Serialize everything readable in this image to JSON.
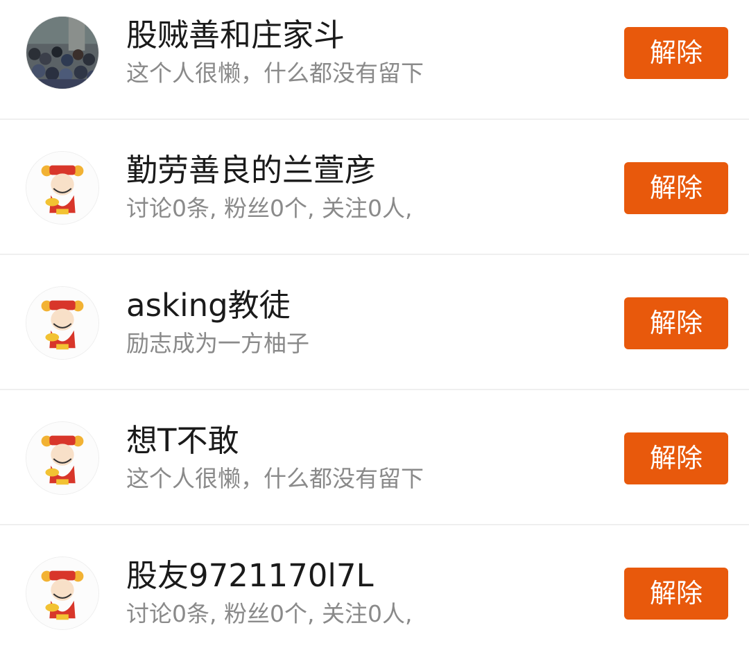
{
  "users": [
    {
      "name": "股贼善和庄家斗",
      "description": "这个人很懒，什么都没有留下",
      "avatar": "crowd-photo-avatar",
      "action_label": "解除"
    },
    {
      "name": "勤劳善良的兰萱彦",
      "description": "讨论0条, 粉丝0个, 关注0人,",
      "avatar": "god-of-wealth-avatar",
      "action_label": "解除"
    },
    {
      "name": "asking教徒",
      "description": "励志成为一方柚子",
      "avatar": "god-of-wealth-avatar",
      "action_label": "解除"
    },
    {
      "name": "想T不敢",
      "description": "这个人很懒，什么都没有留下",
      "avatar": "god-of-wealth-avatar",
      "action_label": "解除"
    },
    {
      "name": "股友9721170l7L",
      "description": "讨论0条, 粉丝0个, 关注0人,",
      "avatar": "god-of-wealth-avatar",
      "action_label": "解除"
    }
  ],
  "colors": {
    "accent": "#e8590c",
    "name_text": "#1a1a1a",
    "desc_text": "#8a8a8a",
    "divider": "#efefef"
  }
}
